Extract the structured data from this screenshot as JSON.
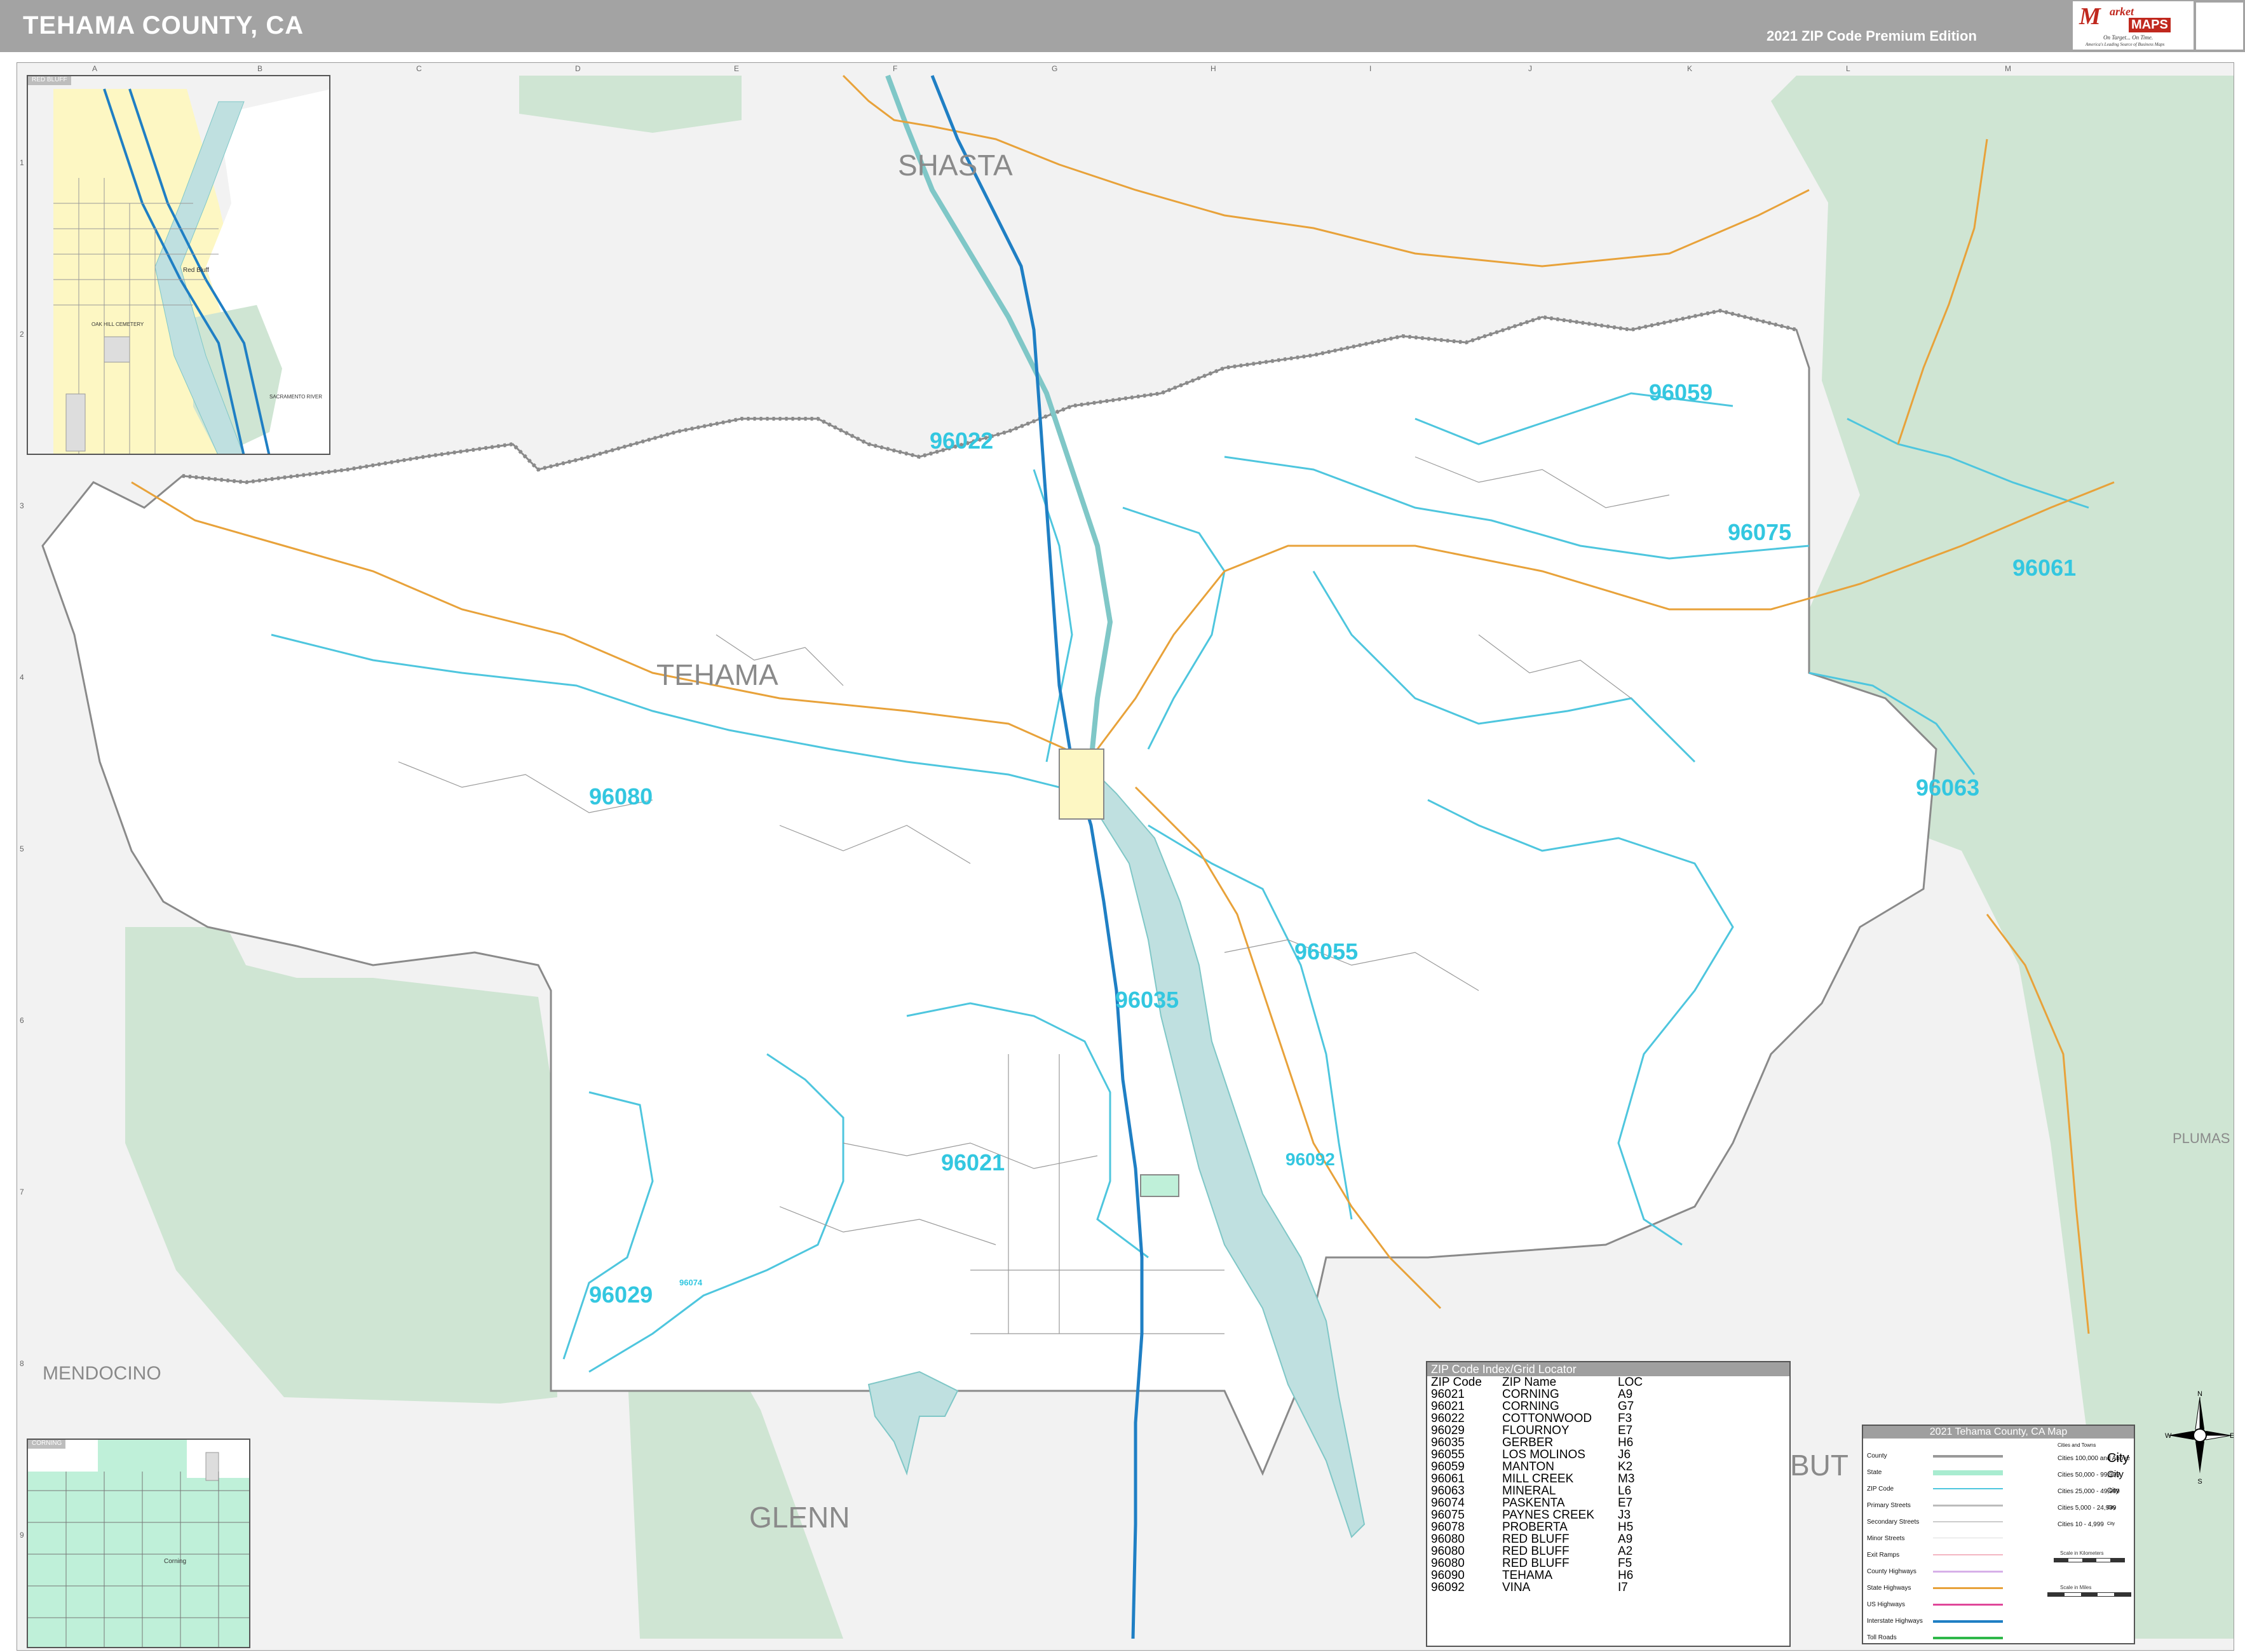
{
  "header": {
    "title": "TEHAMA COUNTY, CA",
    "edition": "2021 ZIP Code Premium Edition",
    "logo_word1": "M",
    "logo_word2": "arket",
    "logo_word3": "MAPS",
    "logo_tagline": "On Target... On Time.",
    "logo_tagline2": "America's Leading Source of Business Maps"
  },
  "grid": {
    "columns": [
      "A",
      "B",
      "C",
      "D",
      "E",
      "F",
      "G",
      "H",
      "I",
      "J",
      "K",
      "L",
      "M"
    ],
    "rows": [
      "1",
      "2",
      "3",
      "4",
      "5",
      "6",
      "7",
      "8",
      "9"
    ]
  },
  "regions": {
    "shasta": "SHASTA",
    "tehama": "TEHAMA",
    "glenn": "GLENN",
    "mendocino": "MENDOCINO",
    "plumas": "PLUMAS",
    "butte": "BUT"
  },
  "zip_labels": [
    {
      "code": "96022"
    },
    {
      "code": "96059"
    },
    {
      "code": "96075"
    },
    {
      "code": "96061"
    },
    {
      "code": "96080"
    },
    {
      "code": "96063"
    },
    {
      "code": "96055"
    },
    {
      "code": "96035"
    },
    {
      "code": "96021"
    },
    {
      "code": "96092"
    },
    {
      "code": "96029"
    },
    {
      "code": "96074"
    }
  ],
  "insets": {
    "red_bluff": {
      "title": "RED BLUFF",
      "labels": [
        "Red Bluff",
        "OAK HILL CEMETERY",
        "SACRAMENTO RIVER"
      ]
    },
    "corning": {
      "title": "CORNING",
      "labels": [
        "Corning"
      ]
    }
  },
  "zip_index": {
    "title": "ZIP Code Index/Grid Locator",
    "headers": [
      "ZIP Code",
      "ZIP Name",
      "LOC"
    ],
    "rows": [
      [
        "96021",
        "CORNING",
        "A9"
      ],
      [
        "96021",
        "CORNING",
        "G7"
      ],
      [
        "96022",
        "COTTONWOOD",
        "F3"
      ],
      [
        "96029",
        "FLOURNOY",
        "E7"
      ],
      [
        "96035",
        "GERBER",
        "H6"
      ],
      [
        "96055",
        "LOS MOLINOS",
        "J6"
      ],
      [
        "96059",
        "MANTON",
        "K2"
      ],
      [
        "96061",
        "MILL CREEK",
        "M3"
      ],
      [
        "96063",
        "MINERAL",
        "L6"
      ],
      [
        "96074",
        "PASKENTA",
        "E7"
      ],
      [
        "96075",
        "PAYNES CREEK",
        "J3"
      ],
      [
        "96078",
        "PROBERTA",
        "H5"
      ],
      [
        "96080",
        "RED BLUFF",
        "A9"
      ],
      [
        "96080",
        "RED BLUFF",
        "A2"
      ],
      [
        "96080",
        "RED BLUFF",
        "F5"
      ],
      [
        "96090",
        "TEHAMA",
        "H6"
      ],
      [
        "96092",
        "VINA",
        "I7"
      ]
    ]
  },
  "legend": {
    "title": "2021 Tehama County, CA Map",
    "items": [
      "County",
      "State",
      "ZIP Code",
      "Primary Streets",
      "Secondary Streets",
      "Minor Streets",
      "Exit Ramps",
      "County Highways",
      "State Highways",
      "US Highways",
      "Interstate Highways",
      "Toll Roads"
    ],
    "cities_header": "Cities and Towns",
    "cities": [
      {
        "label": "Cities 100,000 and Above",
        "sym": "City"
      },
      {
        "label": "Cities 50,000 - 99,999",
        "sym": "City"
      },
      {
        "label": "Cities 25,000 - 49,999",
        "sym": "City"
      },
      {
        "label": "Cities 5,000 - 24,999",
        "sym": "City"
      },
      {
        "label": "Cities 10 - 4,999",
        "sym": "City"
      }
    ],
    "scale_km": "Scale in Kilometers",
    "scale_mi": "Scale in Miles"
  },
  "compass": {
    "n": "N",
    "s": "S",
    "e": "E",
    "w": "W"
  },
  "colors": {
    "county_fill": "#ffffff",
    "outside_fill": "#f2f2f2",
    "forest": "#cfe5d3",
    "water": "#bfe0e0",
    "zip_boundary": "#4ec6de",
    "interstate": "#1f7fc4",
    "state_highway": "#e8a23a",
    "header_gray": "#a3a3a3"
  }
}
